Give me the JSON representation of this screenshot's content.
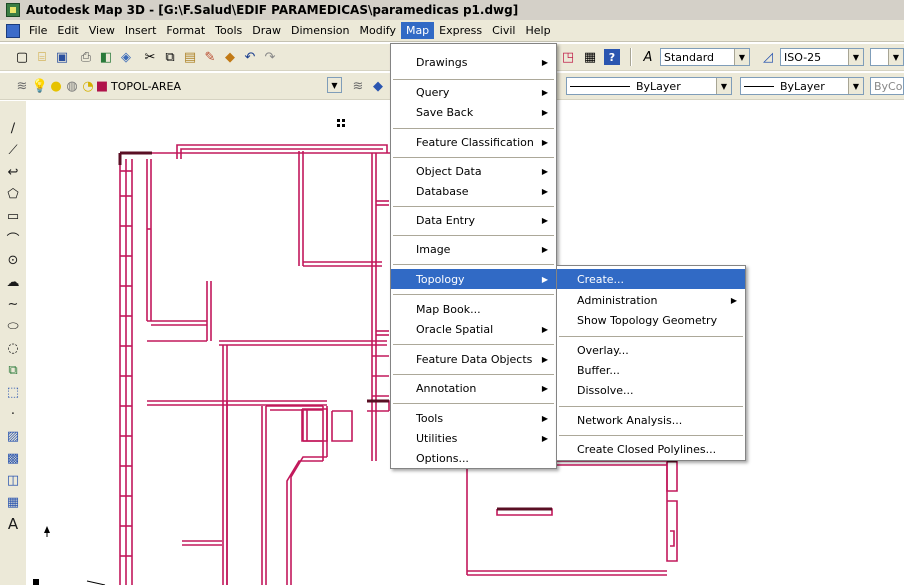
{
  "window": {
    "title": "Autodesk Map 3D - [G:\\F.Salud\\EDIF PARAMEDICAS\\paramedicas p1.dwg]"
  },
  "menubar": {
    "items": [
      "File",
      "Edit",
      "View",
      "Insert",
      "Format",
      "Tools",
      "Draw",
      "Dimension",
      "Modify",
      "Map",
      "Express",
      "Civil",
      "Help"
    ],
    "active": "Map"
  },
  "toolbar": {
    "text_style": "Standard",
    "dim_style": "ISO-25",
    "layer": "TOPOL-AREA",
    "linetype": "ByLayer",
    "lineweight": "ByLayer",
    "color": "ByCo"
  },
  "map_menu": {
    "items": [
      {
        "label": "Drawings",
        "submenu": true
      },
      {
        "label": "Query",
        "submenu": true
      },
      {
        "label": "Save Back",
        "submenu": true
      },
      {
        "label": "Feature Classification",
        "submenu": true
      },
      {
        "label": "Object Data",
        "submenu": true
      },
      {
        "label": "Database",
        "submenu": true
      },
      {
        "label": "Data Entry",
        "submenu": true
      },
      {
        "label": "Image",
        "submenu": true
      },
      {
        "label": "Topology",
        "submenu": true,
        "highlighted": true
      },
      {
        "label": "Map Book...",
        "submenu": false
      },
      {
        "label": "Oracle Spatial",
        "submenu": true
      },
      {
        "label": "Feature Data Objects",
        "submenu": true
      },
      {
        "label": "Annotation",
        "submenu": true
      },
      {
        "label": "Tools",
        "submenu": true
      },
      {
        "label": "Utilities",
        "submenu": true
      },
      {
        "label": "Options...",
        "submenu": false
      }
    ]
  },
  "topology_menu": {
    "items": [
      {
        "label": "Create...",
        "submenu": false,
        "highlighted": true
      },
      {
        "label": "Administration",
        "submenu": true
      },
      {
        "label": "Show Topology Geometry",
        "submenu": false
      },
      {
        "label": "Overlay...",
        "submenu": false
      },
      {
        "label": "Buffer...",
        "submenu": false
      },
      {
        "label": "Dissolve...",
        "submenu": false
      },
      {
        "label": "Network Analysis...",
        "submenu": false
      },
      {
        "label": "Create Closed Polylines...",
        "submenu": false
      }
    ]
  },
  "colors": {
    "drawing_lines": "#c2185b",
    "menu_highlight": "#316ac5",
    "chrome": "#ece9d8"
  },
  "left_toolbar_icons": [
    "line-icon",
    "construction-line-icon",
    "polyline-icon",
    "polygon-icon",
    "rectangle-icon",
    "arc-icon",
    "circle-icon",
    "revision-cloud-icon",
    "spline-icon",
    "ellipse-icon",
    "ellipse-arc-icon",
    "insert-block-icon",
    "make-block-icon",
    "point-icon",
    "hatch-icon",
    "gradient-icon",
    "region-icon",
    "table-icon",
    "multiline-text-icon"
  ]
}
